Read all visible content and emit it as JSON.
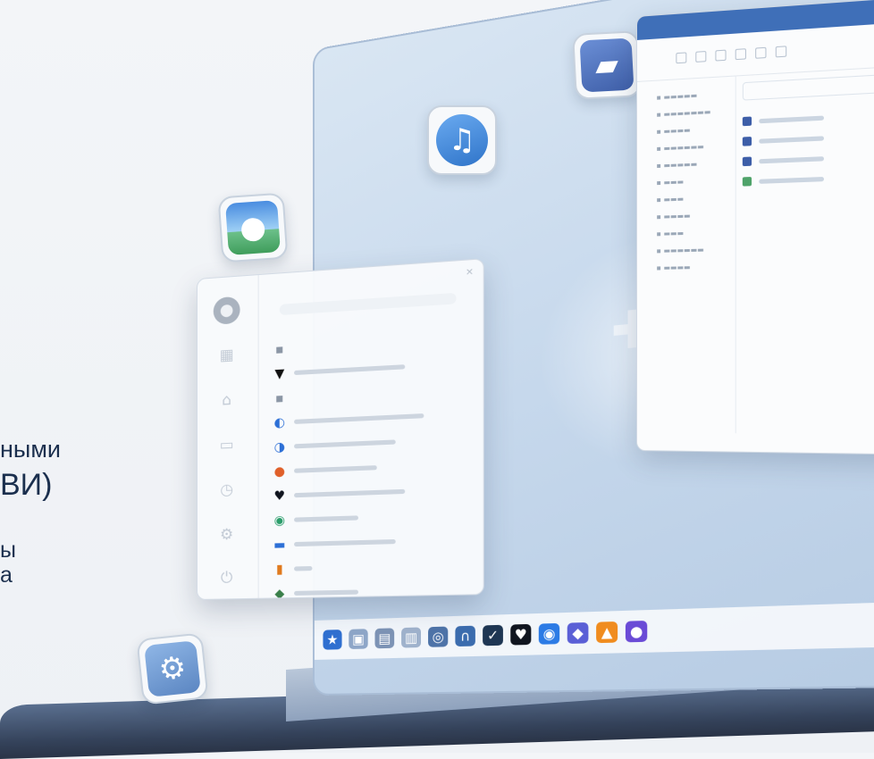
{
  "promo": {
    "line1": "ными",
    "line2": "ВИ)",
    "line3": "ы",
    "line4": "а"
  },
  "icons": {
    "folder": "folder-icon",
    "music": "music-note-icon",
    "photo": "photo-icon",
    "settings": "gear-icon",
    "center_logo": "distro-logo-icon"
  },
  "taskbar": {
    "items": [
      "star-icon",
      "files-icon",
      "folder-icon",
      "document-icon",
      "browser-icon",
      "headset-icon",
      "bird-icon",
      "heart-icon",
      "chrome-icon",
      "gamepad-icon",
      "vlc-icon",
      "app-icon"
    ]
  },
  "colors": {
    "accent": "#3f6fb8",
    "text_dark": "#1b2f4e",
    "screen_bg": "#c6d8ec"
  }
}
